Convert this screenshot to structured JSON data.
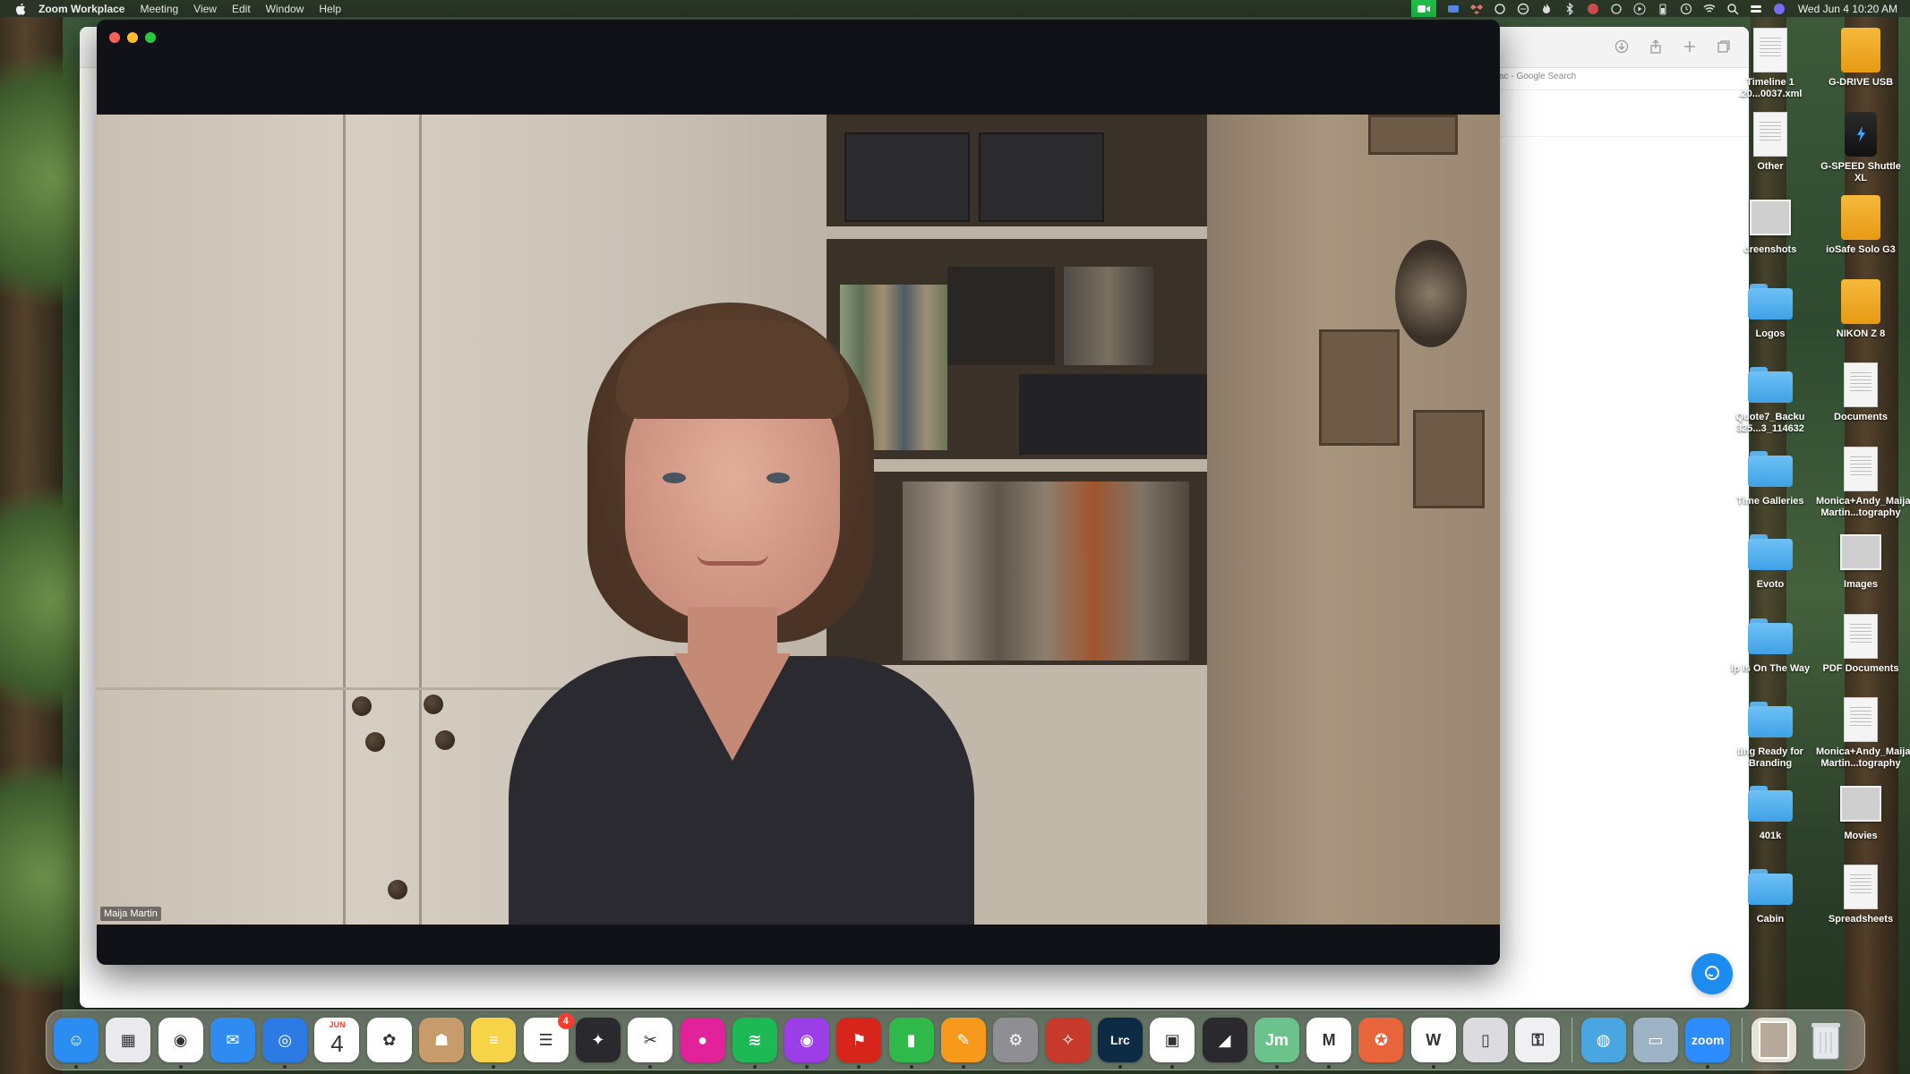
{
  "menubar": {
    "app_name": "Zoom Workplace",
    "menus": [
      "Meeting",
      "View",
      "Edit",
      "Window",
      "Help"
    ],
    "clock": "Wed Jun 4  10:20 AM"
  },
  "browser": {
    "tab_title": "ac - Google Search"
  },
  "zoom": {
    "participant_name": "Maija Martin"
  },
  "desktop": {
    "icons": [
      {
        "label": "Timeline 1 .20...0037.xml",
        "type": "document"
      },
      {
        "label": "G-DRIVE USB",
        "type": "drive"
      },
      {
        "label": "Other",
        "type": "document"
      },
      {
        "label": "G-SPEED Shuttle XL",
        "type": "dark-drive"
      },
      {
        "label": "creenshots",
        "type": "image"
      },
      {
        "label": "ioSafe Solo G3",
        "type": "drive"
      },
      {
        "label": "Logos",
        "type": "folder"
      },
      {
        "label": "NIKON Z 8",
        "type": "drive"
      },
      {
        "label": "Quote7_Backu 325...3_114632",
        "type": "folder"
      },
      {
        "label": "Documents",
        "type": "document"
      },
      {
        "label": "Time Galleries",
        "type": "folder"
      },
      {
        "label": "Monica+Andy_Maija Martin...tography",
        "type": "document"
      },
      {
        "label": "Evoto",
        "type": "folder"
      },
      {
        "label": "Images",
        "type": "image"
      },
      {
        "label": "lp Is On The Way",
        "type": "folder"
      },
      {
        "label": "PDF Documents",
        "type": "document"
      },
      {
        "label": "ting Ready for Branding",
        "type": "folder"
      },
      {
        "label": "Monica+Andy_Maija Martin...tography",
        "type": "document"
      },
      {
        "label": "401k",
        "type": "folder"
      },
      {
        "label": "Movies",
        "type": "image"
      },
      {
        "label": "Cabin",
        "type": "folder"
      },
      {
        "label": "Spreadsheets",
        "type": "document"
      }
    ]
  },
  "dock": {
    "calendar_month": "JUN",
    "calendar_day": "4",
    "reminders_badge": "4",
    "apps": [
      {
        "name": "finder-app",
        "color": "#2b8cf1",
        "glyph": "☺"
      },
      {
        "name": "launchpad-app",
        "color": "#e9e9ee",
        "glyph": "▦"
      },
      {
        "name": "chrome-app",
        "color": "#ffffff",
        "glyph": "◉"
      },
      {
        "name": "mail-app",
        "color": "#2f8bf0",
        "glyph": "✉"
      },
      {
        "name": "safari-app",
        "color": "#2c7be5",
        "glyph": "◎"
      },
      {
        "name": "calendar-app",
        "color": "#ffffff",
        "glyph": ""
      },
      {
        "name": "photos-app",
        "color": "#ffffff",
        "glyph": "✿"
      },
      {
        "name": "contacts-app",
        "color": "#c89b6a",
        "glyph": "☗"
      },
      {
        "name": "notes-app",
        "color": "#f7d348",
        "glyph": "≡"
      },
      {
        "name": "reminders-app",
        "color": "#ffffff",
        "glyph": "☰"
      },
      {
        "name": "davinci-resolve-app",
        "color": "#2a2a2e",
        "glyph": "✦"
      },
      {
        "name": "capcut-app",
        "color": "#ffffff",
        "glyph": "✂"
      },
      {
        "name": "screen-recorder-app",
        "color": "#e2229a",
        "glyph": "●"
      },
      {
        "name": "spotify-app",
        "color": "#1db954",
        "glyph": "≋"
      },
      {
        "name": "podcasts-app",
        "color": "#9b3ee8",
        "glyph": "◉"
      },
      {
        "name": "acrobat-app",
        "color": "#d7251b",
        "glyph": "⚑"
      },
      {
        "name": "numbers-app",
        "color": "#2fb94a",
        "glyph": "▮"
      },
      {
        "name": "pages-app",
        "color": "#f79a1c",
        "glyph": "✎"
      },
      {
        "name": "system-settings-app",
        "color": "#8e8e93",
        "glyph": "⚙"
      },
      {
        "name": "compass-app",
        "color": "#c73a2b",
        "glyph": "✧"
      },
      {
        "name": "lightroom-classic-app",
        "color": "#0d2b45",
        "glyph": "Lrc"
      },
      {
        "name": "fotoquote-app",
        "color": "#ffffff",
        "glyph": "▣"
      },
      {
        "name": "keynote-app",
        "color": "#2a2a2e",
        "glyph": "◢"
      },
      {
        "name": "jm-app",
        "color": "#6bc38b",
        "glyph": "Jm"
      },
      {
        "name": "m-app",
        "color": "#ffffff",
        "glyph": "M"
      },
      {
        "name": "web-app",
        "color": "#e8643b",
        "glyph": "✪"
      },
      {
        "name": "w-app",
        "color": "#ffffff",
        "glyph": "W"
      },
      {
        "name": "preview-app",
        "color": "#dcdce0",
        "glyph": "▯"
      },
      {
        "name": "keychain-app",
        "color": "#f0f0f2",
        "glyph": "⚿"
      },
      {
        "name": "remote-desktop-app",
        "color": "#4aa6e0",
        "glyph": "◍"
      },
      {
        "name": "screen-sharing-app",
        "color": "#9fb3c7",
        "glyph": "▭"
      },
      {
        "name": "zoom-app",
        "color": "#2d8cff",
        "glyph": "zoom"
      }
    ]
  },
  "colors": {
    "zoom_green": "#1fbf4a",
    "chat_blue": "#1c8cf0",
    "badge_red": "#ff3b30"
  }
}
